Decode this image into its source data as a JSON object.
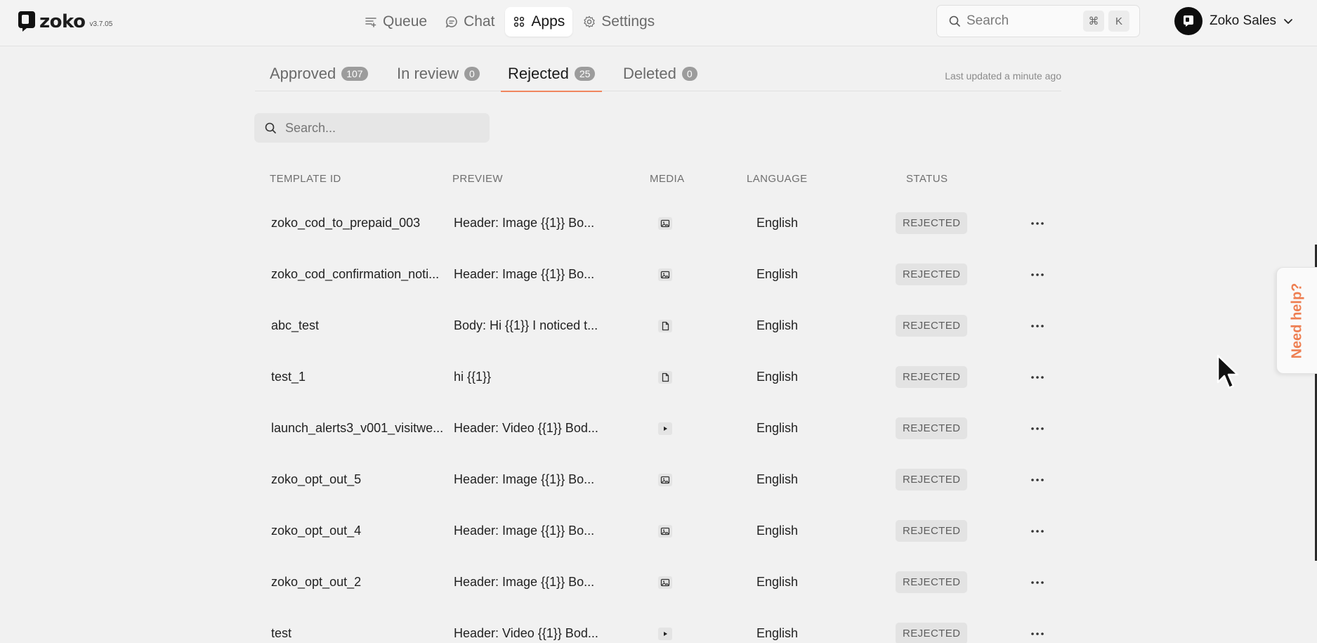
{
  "app": {
    "name": "zoko",
    "version": "v3.7.05"
  },
  "nav": {
    "items": [
      {
        "label": "Queue",
        "icon": "queue-icon"
      },
      {
        "label": "Chat",
        "icon": "chat-icon"
      },
      {
        "label": "Apps",
        "icon": "apps-grid-icon",
        "active": true
      },
      {
        "label": "Settings",
        "icon": "settings-gear-icon"
      }
    ]
  },
  "search": {
    "placeholder": "Search",
    "shortcut_modifier": "⌘",
    "shortcut_key": "K"
  },
  "account": {
    "name": "Zoko Sales",
    "icon": "chevron-down-icon"
  },
  "tabs": [
    {
      "label": "Approved",
      "count": "107"
    },
    {
      "label": "In review",
      "count": "0"
    },
    {
      "label": "Rejected",
      "count": "25",
      "active": true
    },
    {
      "label": "Deleted",
      "count": "0"
    }
  ],
  "last_updated": "Last updated a minute ago",
  "table_search": {
    "placeholder": "Search..."
  },
  "table": {
    "headers": {
      "template_id": "TEMPLATE ID",
      "preview": "PREVIEW",
      "media": "MEDIA",
      "language": "LANGUAGE",
      "status": "STATUS"
    },
    "rows": [
      {
        "template_id": "zoko_cod_to_prepaid_003",
        "preview": "Header: Image {{1}} Bo...",
        "media": "image",
        "language": "English",
        "status": "REJECTED"
      },
      {
        "template_id": "zoko_cod_confirmation_noti...",
        "preview": "Header: Image {{1}} Bo...",
        "media": "image",
        "language": "English",
        "status": "REJECTED"
      },
      {
        "template_id": "abc_test",
        "preview": "Body: Hi {{1}} I noticed t...",
        "media": "document",
        "language": "English",
        "status": "REJECTED"
      },
      {
        "template_id": "test_1",
        "preview": "hi {{1}}",
        "media": "document",
        "language": "English",
        "status": "REJECTED"
      },
      {
        "template_id": "launch_alerts3_v001_visitwe...",
        "preview": "Header: Video {{1}} Bod...",
        "media": "video",
        "language": "English",
        "status": "REJECTED"
      },
      {
        "template_id": "zoko_opt_out_5",
        "preview": "Header: Image {{1}} Bo...",
        "media": "image",
        "language": "English",
        "status": "REJECTED"
      },
      {
        "template_id": "zoko_opt_out_4",
        "preview": "Header: Image {{1}} Bo...",
        "media": "image",
        "language": "English",
        "status": "REJECTED"
      },
      {
        "template_id": "zoko_opt_out_2",
        "preview": "Header: Image {{1}} Bo...",
        "media": "image",
        "language": "English",
        "status": "REJECTED"
      },
      {
        "template_id": "test",
        "preview": "Header: Video {{1}} Bod...",
        "media": "video",
        "language": "English",
        "status": "REJECTED"
      }
    ]
  },
  "help": {
    "label": "Need help?"
  },
  "colors": {
    "accent": "#f0865e",
    "help_text": "#ee7f52",
    "tab_count_bg": "#9c9c9c",
    "badge_bg": "#e3e3e3"
  }
}
